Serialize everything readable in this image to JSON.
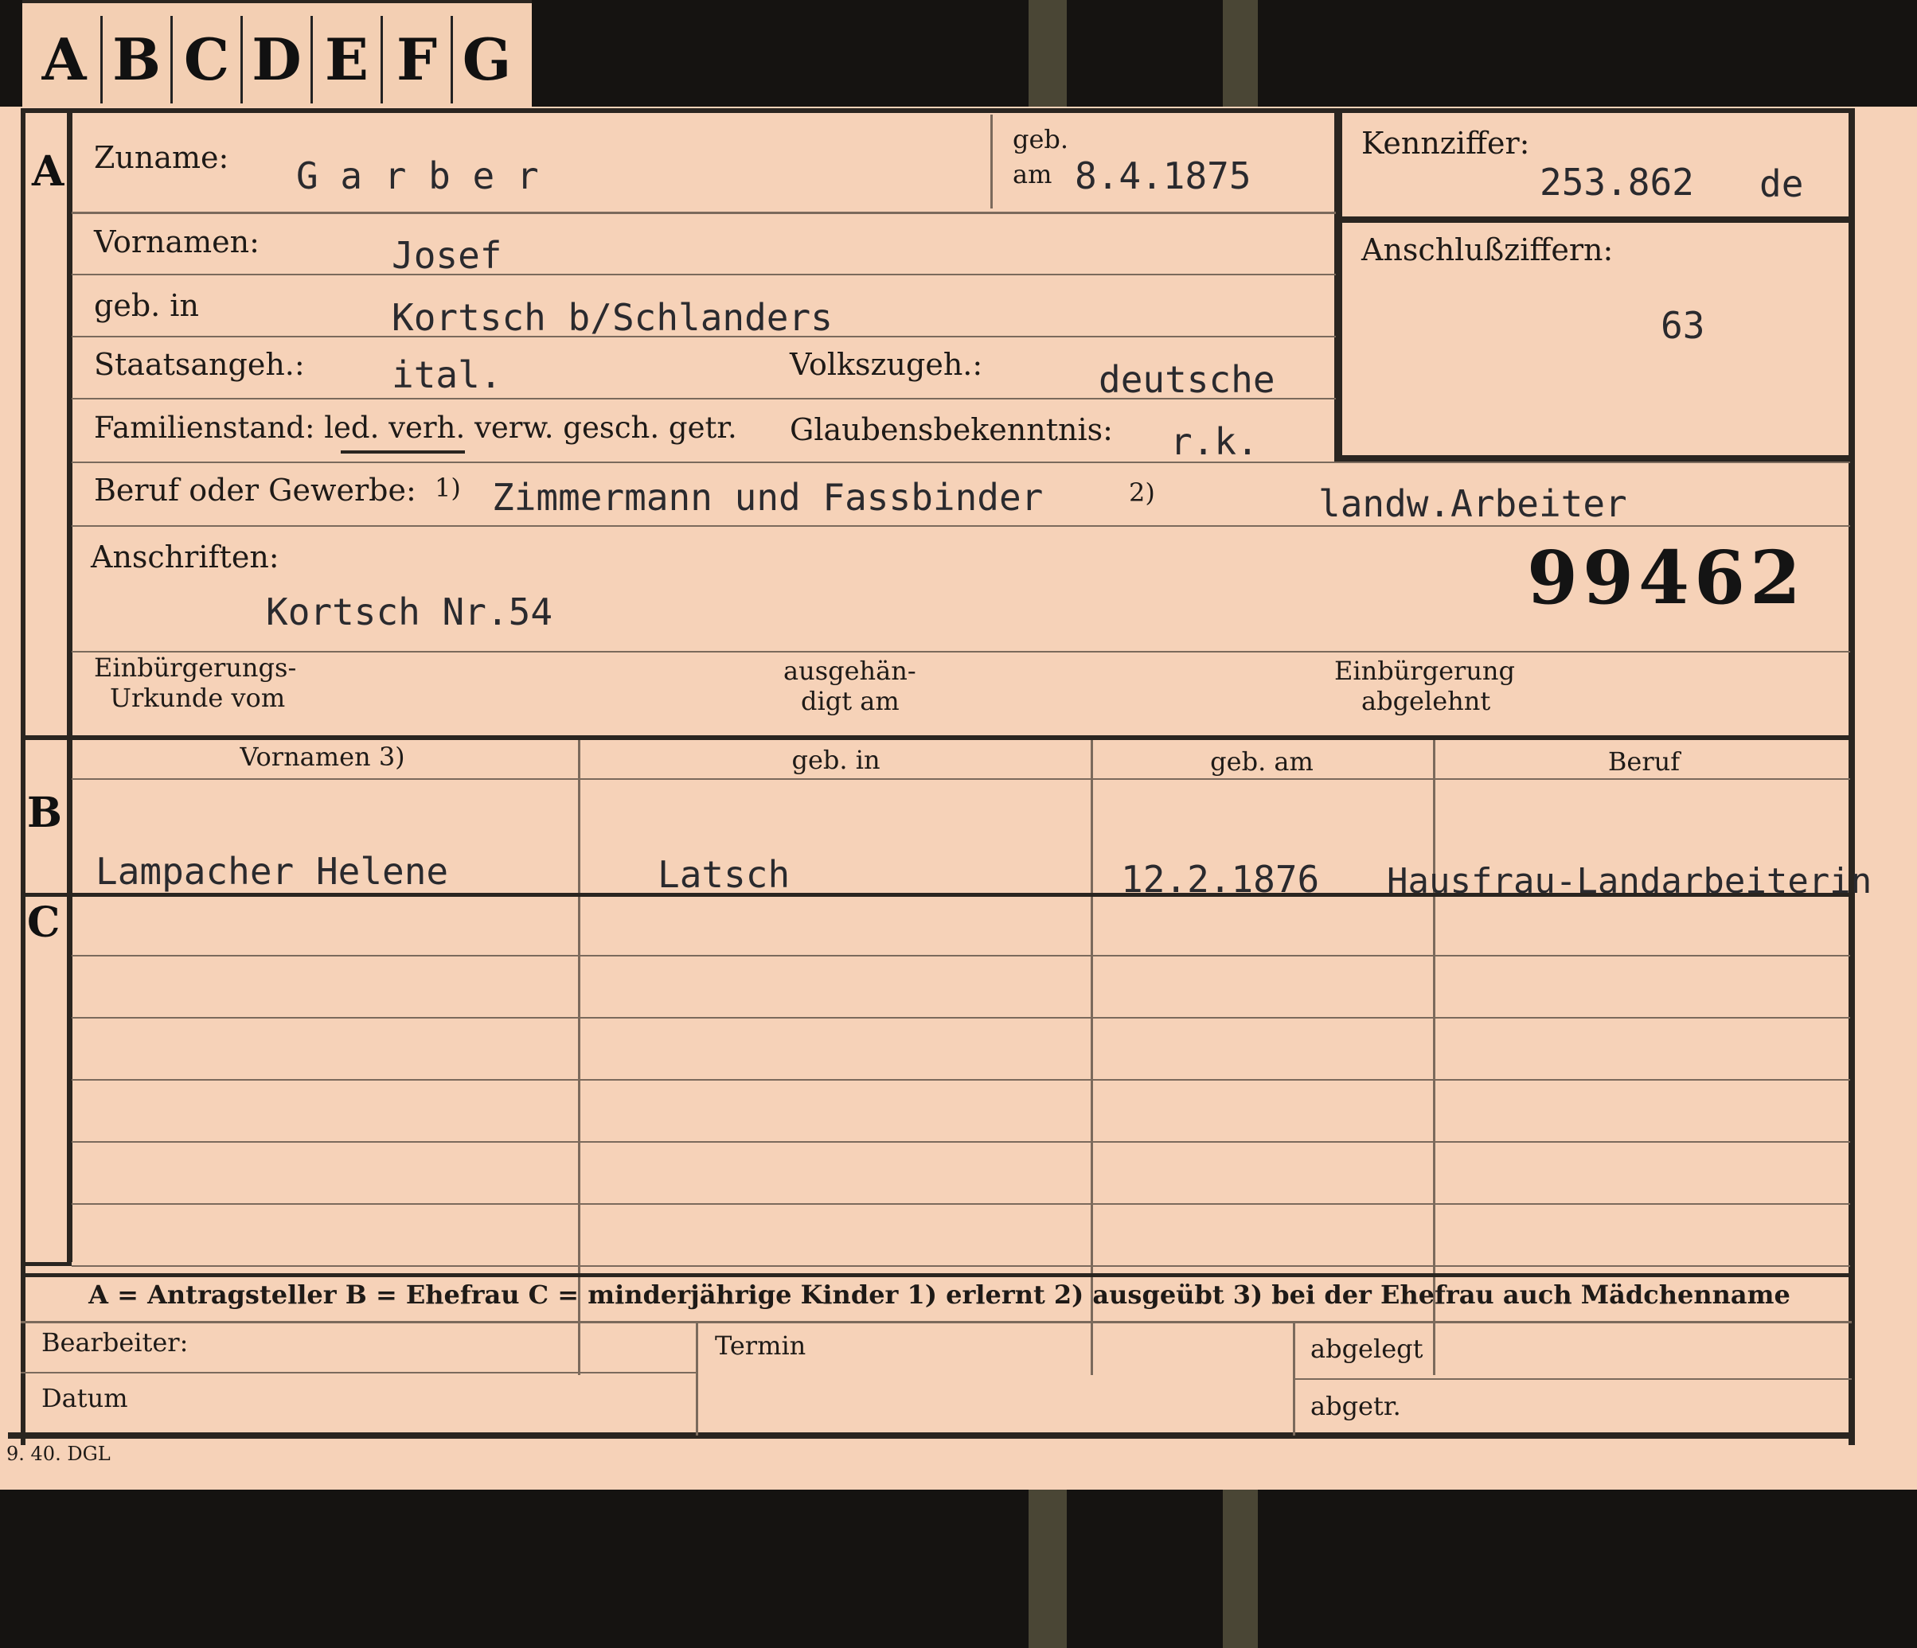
{
  "tabs": [
    "A",
    "B",
    "C",
    "D",
    "E",
    "F",
    "G"
  ],
  "sections": {
    "a": "A",
    "b": "B",
    "c": "C"
  },
  "labels": {
    "zuname": "Zuname:",
    "geb": "geb.",
    "am": "am",
    "kennziffer": "Kennziffer:",
    "vornamen": "Vornamen:",
    "anschlussziffern": "Anschlußziffern:",
    "geb_in": "geb. in",
    "staatsangeh": "Staatsangeh.:",
    "volkszugeh": "Volkszugeh.:",
    "familienstand": "Familienstand: led. verh. verw. gesch. getr.",
    "glaubensbekenntnis": "Glaubensbekenntnis:",
    "beruf": "Beruf oder Gewerbe:",
    "note1": "1)",
    "note2": "2)",
    "anschriften": "Anschriften:",
    "einb_urkunde_1": "Einbürgerungs-",
    "einb_urkunde_2": "Urkunde vom",
    "ausgehaendigt_1": "ausgehän-",
    "ausgehaendigt_2": "digt am",
    "einb_abgelehnt_1": "Einbürgerung",
    "einb_abgelehnt_2": "abgelehnt"
  },
  "values": {
    "zuname": "G a r b e r",
    "geb_am": "8.4.1875",
    "kennziffer": "253.862",
    "kennziffer_suffix": "de",
    "vornamen": "Josef",
    "anschlussziffern": "63",
    "geb_in": "Kortsch b/Schlanders",
    "staatsangeh": "ital.",
    "volkszugeh": "deutsche",
    "glaubensbekenntnis": "r.k.",
    "beruf_erlernt": "Zimmermann und Fassbinder",
    "beruf_ausgeuebt": "landw.Arbeiter",
    "anschrift": "Kortsch Nr.54",
    "stamp_number": "99462"
  },
  "table": {
    "headers": [
      "Vornamen 3)",
      "geb. in",
      "geb. am",
      "Beruf"
    ],
    "rows": [
      [
        "Lampacher Helene",
        "Latsch",
        "12.2.1876",
        "Hausfrau-Landarbeiterin"
      ]
    ]
  },
  "legend": "A = Antragsteller   B = Ehefrau   C = minderjährige Kinder   1) erlernt   2) ausgeübt   3) bei der Ehefrau auch Mädchenname",
  "footer": {
    "bearbeiter": "Bearbeiter:",
    "termin": "Termin",
    "abgelegt": "abgelegt",
    "datum": "Datum",
    "abgetr": "abgetr.",
    "print_code": "9. 40. DGL"
  }
}
